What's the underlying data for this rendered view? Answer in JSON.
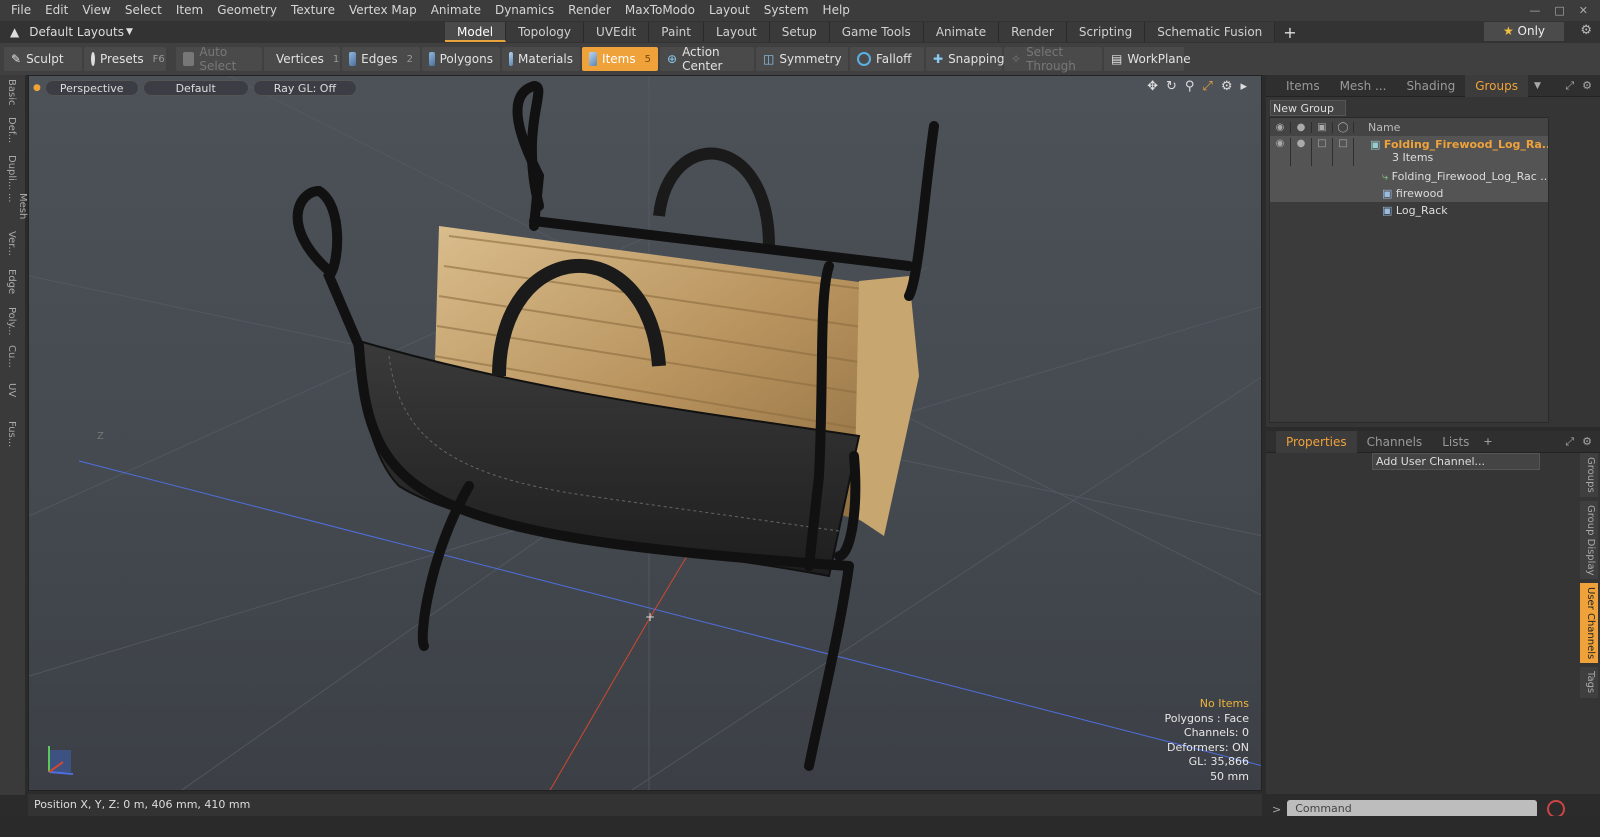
{
  "menu": [
    "File",
    "Edit",
    "View",
    "Select",
    "Item",
    "Geometry",
    "Texture",
    "Vertex Map",
    "Animate",
    "Dynamics",
    "Render",
    "MaxToModo",
    "Layout",
    "System",
    "Help"
  ],
  "layouts": {
    "label": "Default Layouts"
  },
  "mode_tabs": [
    "Model",
    "Topology",
    "UVEdit",
    "Paint",
    "Layout",
    "Setup",
    "Game Tools",
    "Animate",
    "Render",
    "Scripting",
    "Schematic Fusion"
  ],
  "only_label": "Only",
  "toolbar": {
    "sculpt": "Sculpt",
    "presets": "Presets",
    "presets_key": "F6",
    "auto_select": "Auto Select",
    "vertices": "Vertices",
    "vertices_key": "1",
    "edges": "Edges",
    "edges_key": "2",
    "polygons": "Polygons",
    "materials": "Materials",
    "items": "Items",
    "items_key": "5",
    "action_center": "Action Center",
    "symmetry": "Symmetry",
    "falloff": "Falloff",
    "snapping": "Snapping",
    "select_through": "Select Through",
    "workplane": "WorkPlane"
  },
  "left_tabs": [
    "Basic",
    "Def...",
    "Dupli...",
    "Mesh ...",
    "Ver...",
    "Edge",
    "Poly...",
    "Cu...",
    "UV",
    "Fus..."
  ],
  "viewport": {
    "view": "Perspective",
    "shading": "Default",
    "raygl": "Ray GL: Off",
    "info": {
      "items": "No Items",
      "polygons": "Polygons : Face",
      "channels": "Channels: 0",
      "deformers": "Deformers: ON",
      "gl": "GL: 35,866",
      "focal": "50 mm"
    },
    "axis_label": "Z"
  },
  "status": "Position X, Y, Z:  0 m, 406 mm, 410 mm",
  "top_panel": {
    "tabs": [
      "Items",
      "Mesh ...",
      "Shading",
      "Groups"
    ],
    "new_group": "New Group",
    "name_header": "Name",
    "rows": [
      {
        "name": "Folding_Firewood_Log_Ra...",
        "sub": "3 Items"
      },
      {
        "name": "Folding_Firewood_Log_Rac ..."
      },
      {
        "name": "firewood"
      },
      {
        "name": "Log_Rack"
      }
    ]
  },
  "bottom_panel": {
    "tabs": [
      "Properties",
      "Channels",
      "Lists"
    ],
    "add_channel": "Add User Channel...",
    "side_tabs": [
      "Groups",
      "Group Display",
      "User Channels",
      "Tags"
    ]
  },
  "command": {
    "placeholder": "Command"
  }
}
